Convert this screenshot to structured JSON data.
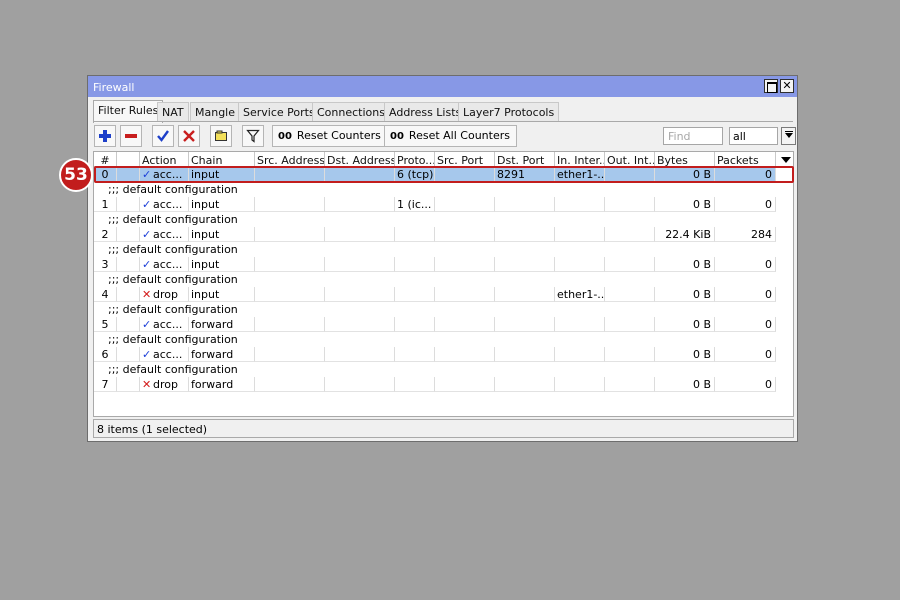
{
  "window": {
    "title": "Firewall"
  },
  "tabs": [
    "Filter Rules",
    "NAT",
    "Mangle",
    "Service Ports",
    "Connections",
    "Address Lists",
    "Layer7 Protocols"
  ],
  "toolbar": {
    "reset_counters": "Reset Counters",
    "reset_all_counters": "Reset All Counters",
    "counter_glyph": "00",
    "find_placeholder": "Find",
    "filter_value": "all"
  },
  "columns": [
    "#",
    "",
    "Action",
    "Chain",
    "Src. Address",
    "Dst. Address",
    "Proto...",
    "Src. Port",
    "Dst. Port",
    "In. Inter...",
    "Out. Int...",
    "Bytes",
    "Packets"
  ],
  "rows": [
    {
      "comment": "",
      "num": "0",
      "action_icon": "check-icon",
      "action": "acc...",
      "chain": "input",
      "src": "",
      "dst": "",
      "proto": "6 (tcp)",
      "sport": "",
      "dport": "8291",
      "in_if": "ether1-...",
      "out_if": "",
      "bytes": "0 B",
      "packets": "0"
    },
    {
      "comment": ";;; default configuration",
      "num": "1",
      "action_icon": "check-icon",
      "action": "acc...",
      "chain": "input",
      "src": "",
      "dst": "",
      "proto": "1 (ic...",
      "sport": "",
      "dport": "",
      "in_if": "",
      "out_if": "",
      "bytes": "0 B",
      "packets": "0"
    },
    {
      "comment": ";;; default configuration",
      "num": "2",
      "action_icon": "check-icon",
      "action": "acc...",
      "chain": "input",
      "src": "",
      "dst": "",
      "proto": "",
      "sport": "",
      "dport": "",
      "in_if": "",
      "out_if": "",
      "bytes": "22.4 KiB",
      "packets": "284"
    },
    {
      "comment": ";;; default configuration",
      "num": "3",
      "action_icon": "check-icon",
      "action": "acc...",
      "chain": "input",
      "src": "",
      "dst": "",
      "proto": "",
      "sport": "",
      "dport": "",
      "in_if": "",
      "out_if": "",
      "bytes": "0 B",
      "packets": "0"
    },
    {
      "comment": ";;; default configuration",
      "num": "4",
      "action_icon": "x-icon",
      "action": "drop",
      "chain": "input",
      "src": "",
      "dst": "",
      "proto": "",
      "sport": "",
      "dport": "",
      "in_if": "ether1-...",
      "out_if": "",
      "bytes": "0 B",
      "packets": "0"
    },
    {
      "comment": ";;; default configuration",
      "num": "5",
      "action_icon": "check-icon",
      "action": "acc...",
      "chain": "forward",
      "src": "",
      "dst": "",
      "proto": "",
      "sport": "",
      "dport": "",
      "in_if": "",
      "out_if": "",
      "bytes": "0 B",
      "packets": "0"
    },
    {
      "comment": ";;; default configuration",
      "num": "6",
      "action_icon": "check-icon",
      "action": "acc...",
      "chain": "forward",
      "src": "",
      "dst": "",
      "proto": "",
      "sport": "",
      "dport": "",
      "in_if": "",
      "out_if": "",
      "bytes": "0 B",
      "packets": "0"
    },
    {
      "comment": ";;; default configuration",
      "num": "7",
      "action_icon": "x-icon",
      "action": "drop",
      "chain": "forward",
      "src": "",
      "dst": "",
      "proto": "",
      "sport": "",
      "dport": "",
      "in_if": "",
      "out_if": "",
      "bytes": "0 B",
      "packets": "0"
    }
  ],
  "selected_row": 0,
  "status": "8 items (1 selected)",
  "annotation": {
    "badge": "53",
    "color": "#c21d1d"
  },
  "colors": {
    "titlebar": "#8798e6",
    "selection": "#a6c8ec",
    "check": "#1a3dd8",
    "cross": "#d31a1a"
  }
}
